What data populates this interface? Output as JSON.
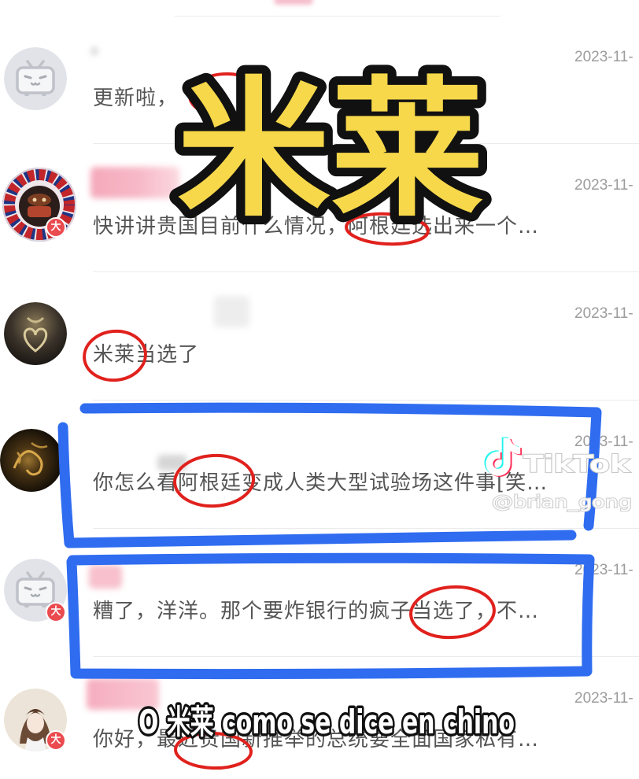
{
  "comments": [
    {
      "avatar": "bilibili-default-tv-avatar",
      "date": "2023-11-",
      "text": "更新啦，"
    },
    {
      "avatar": "ornate-frame-avatar",
      "badge": "大",
      "date": "2023-11-",
      "text": "快讲讲贵国目前什么情况，阿根廷选出来一个…"
    },
    {
      "avatar": "dark-heart-avatar",
      "date": "2023-11-",
      "text": "米莱当选了"
    },
    {
      "avatar": "gold-dragon-avatar",
      "date": "2023-11-",
      "text": "你怎么看阿根廷变成人类大型试验场这件事[笑…"
    },
    {
      "avatar": "bilibili-default-tv-avatar",
      "badge": "大",
      "date": "2023-11-",
      "text": "糟了，洋洋。那个要炸银行的疯子当选了，不…"
    },
    {
      "avatar": "anime-girl-avatar",
      "badge": "大",
      "date": "2023-11-",
      "text": "你好，最近贵国新推举的总统要全面国家私有…"
    }
  ],
  "watermark": {
    "logo_icon": "tiktok-logo-icon",
    "brand": "TikTok",
    "handle": "@brian_gong"
  },
  "overlay": {
    "title": "米莱",
    "subtitle": "O 米莱 como se dice en chino"
  },
  "colors": {
    "title_fill": "#f6d84a",
    "annotation_red": "#e0211d",
    "annotation_blue": "#2f6cf0",
    "badge_red": "#ea4b4f",
    "comment_text": "#555555",
    "date_text": "#9c9c9c"
  }
}
